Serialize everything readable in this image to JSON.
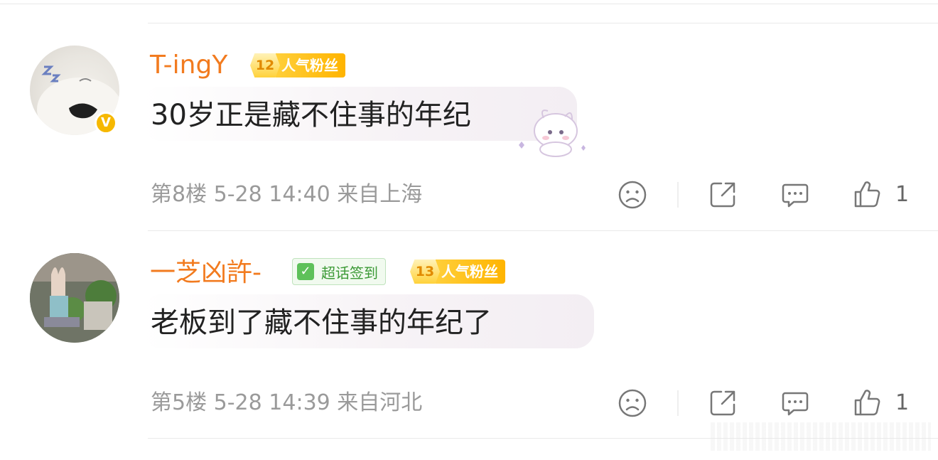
{
  "comments": [
    {
      "username": "T-ingY",
      "verified_badge": "V",
      "fan_level": "12",
      "fan_label": "人气粉丝",
      "text": "30岁正是藏不住事的年纪",
      "floor": "第8楼",
      "date": "5-28",
      "time": "14:40",
      "location": "来自上海",
      "like_count": "1"
    },
    {
      "username": "一芝凶許-",
      "topic_badge": "超话签到",
      "fan_level": "13",
      "fan_label": "人气粉丝",
      "text": "老板到了藏不住事的年纪了",
      "floor": "第5楼",
      "date": "5-28",
      "time": "14:39",
      "location": "来自河北",
      "like_count": "1"
    }
  ],
  "icons": [
    "frown-icon",
    "share-icon",
    "comment-icon",
    "thumbs-up-icon"
  ],
  "colors": {
    "username": "#f27b1f",
    "fan_badge": "#ffbe1a",
    "topic_badge": "#5ec15a",
    "meta": "#9a9a9a"
  }
}
